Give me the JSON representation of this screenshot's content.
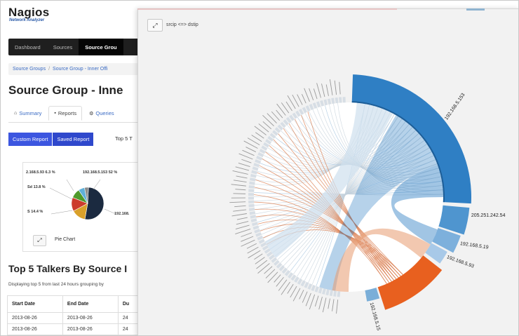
{
  "app": {
    "logo_text": "Nagios",
    "logo_subtext": "Network Analyzer"
  },
  "nav": {
    "items": [
      {
        "label": "Dashboard",
        "active": false
      },
      {
        "label": "Sources",
        "active": false
      },
      {
        "label": "Source Grou",
        "active": true
      }
    ]
  },
  "breadcrumb": {
    "items": [
      "Source Groups",
      "Source Group - Inner Offi"
    ]
  },
  "page": {
    "title": "Source Group - Inne"
  },
  "tabs": [
    {
      "label": "Summary",
      "icon": "home-icon",
      "active": false
    },
    {
      "label": "Reports",
      "icon": "report-icon",
      "active": true
    },
    {
      "label": "Queries",
      "icon": "gear-icon",
      "active": false
    }
  ],
  "report_buttons": {
    "custom_label": "Custom Report",
    "saved_label": "Saved Report",
    "top5_label": "Top 5 T"
  },
  "pie": {
    "caption": "Pie Chart",
    "expand_icon": "expand-icon",
    "slices": [
      {
        "label": "192.168.5.153",
        "share": 52.0,
        "color": "#1b2a40"
      },
      {
        "label": "S",
        "share": 14.4,
        "color": "#d9a02a"
      },
      {
        "label": "Sd",
        "share": 13.8,
        "color": "#cc3b2c"
      },
      {
        "label": "",
        "share": 9.5,
        "color": "#4f9a2c"
      },
      {
        "label": "2.168.5.93",
        "share": 6.3,
        "color": "#5fb0d9"
      },
      {
        "label": "",
        "share": 4.0,
        "color": "#8b8b8b"
      }
    ],
    "labels": {
      "l1": "2.168.5.93",
      "l1_pct": "6.3 %",
      "l2": "192.168.5.153",
      "l2_pct": "52 %",
      "l3": "Sd",
      "l3_pct": "13.8 %",
      "l4": "S",
      "l4_pct": "14.4 %",
      "l5": "192.168."
    }
  },
  "section": {
    "title": "Top 5 Talkers By Source I",
    "subtitle": "Displaying top 5 from last 24 hours grouping by"
  },
  "table": {
    "headers": [
      "Start Date",
      "End Date",
      "Du"
    ],
    "rows": [
      [
        "2013-08-26",
        "2013-08-26",
        "24"
      ],
      [
        "2013-08-26",
        "2013-08-26",
        "24"
      ]
    ]
  },
  "overlay": {
    "title": "srcip <=> dstip",
    "tool_icon": "expand-icon",
    "chord_labels": {
      "a": "192.168.5.153",
      "b": "205.251.242.54",
      "c": "192.168.5.19",
      "d": "192.168.5.93",
      "e": "192.168.5.15"
    }
  },
  "colors": {
    "chord_blue": "#2f7fc4",
    "chord_orange": "#e8601f",
    "nav_bg": "#1f1f1f",
    "button_blue": "#3c56e0",
    "link_blue": "#3a6bc4"
  }
}
